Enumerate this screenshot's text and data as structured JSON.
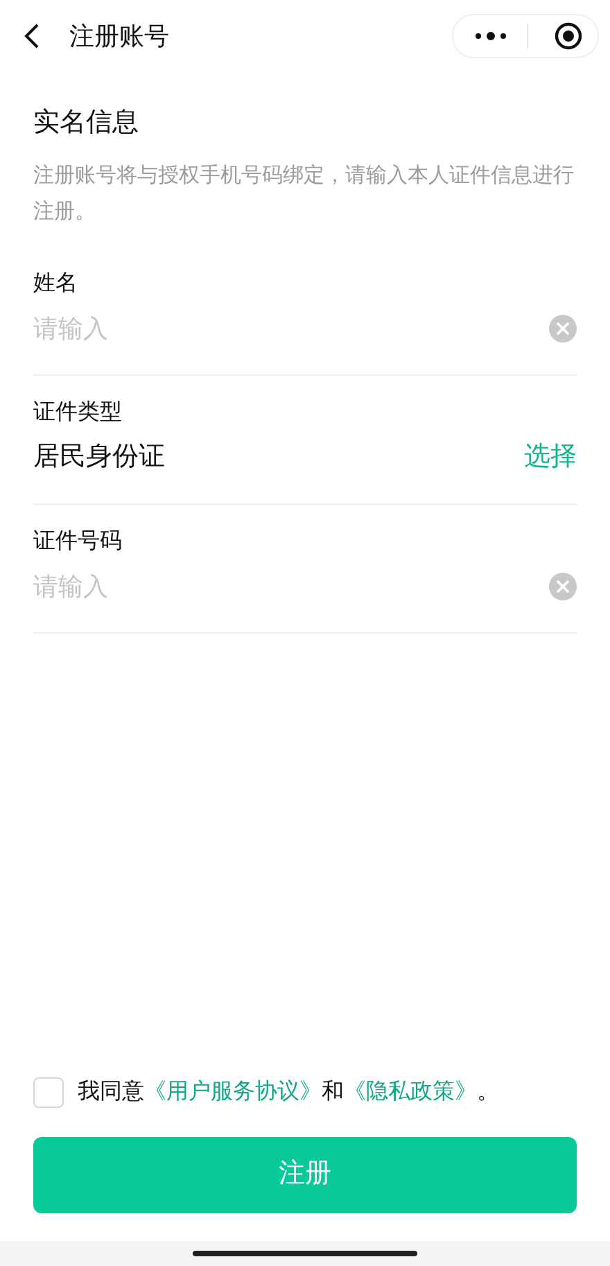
{
  "nav": {
    "title": "注册账号"
  },
  "section": {
    "title": "实名信息",
    "description": "注册账号将与授权手机号码绑定，请输入本人证件信息进行注册。"
  },
  "fields": [
    {
      "kind": "input",
      "label": "姓名",
      "placeholder": "请输入"
    },
    {
      "kind": "select",
      "label": "证件类型",
      "value": "居民身份证",
      "action": "选择"
    },
    {
      "kind": "input",
      "label": "证件号码",
      "placeholder": "请输入"
    }
  ],
  "agreement": {
    "checked": false,
    "parts": [
      {
        "kind": "text",
        "text": "我同意"
      },
      {
        "kind": "link",
        "text": "《用户服务协议》"
      },
      {
        "kind": "text",
        "text": "和"
      },
      {
        "kind": "link",
        "text": "《隐私政策》"
      },
      {
        "kind": "text",
        "text": "。"
      }
    ]
  },
  "submit": {
    "label": "注册"
  }
}
